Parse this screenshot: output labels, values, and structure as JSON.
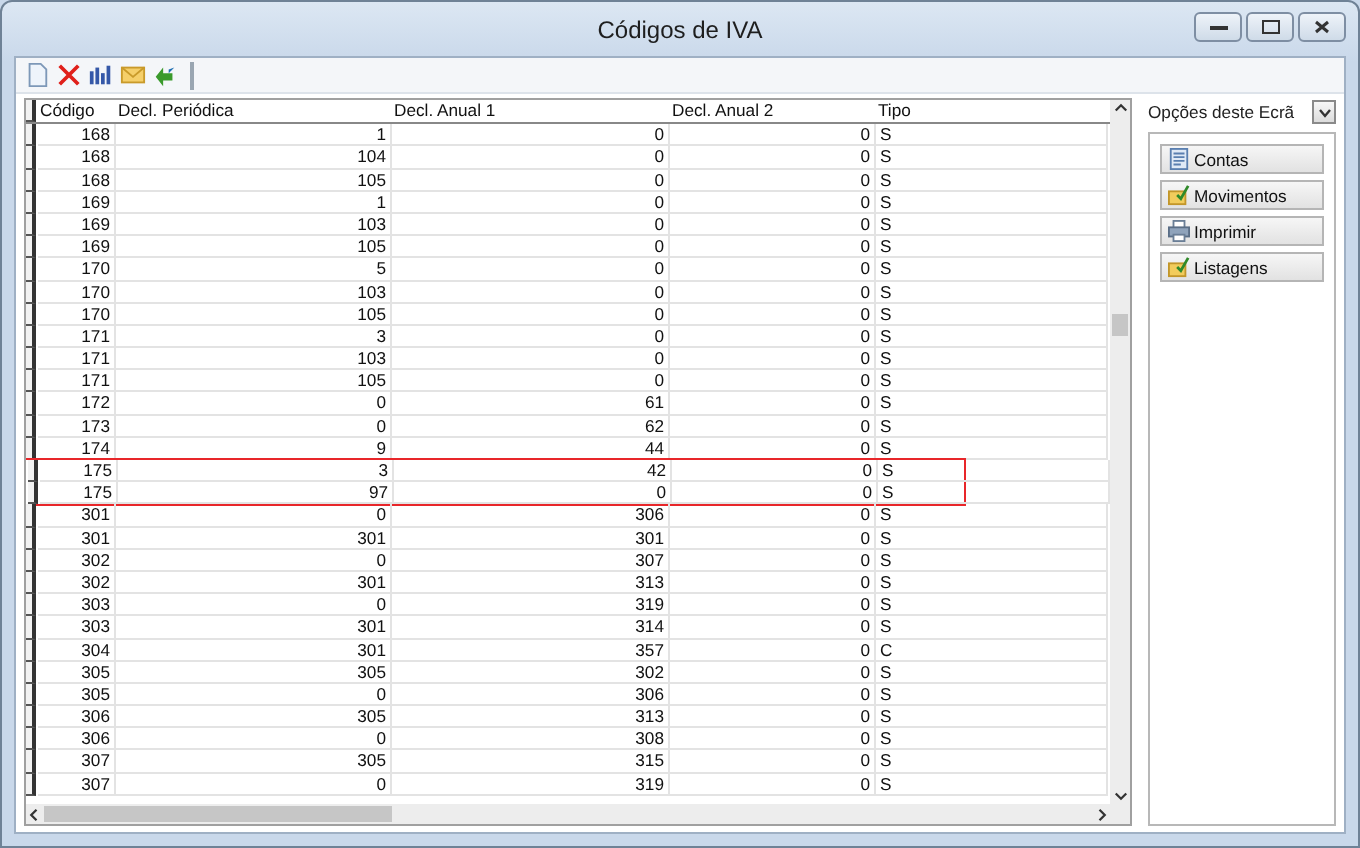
{
  "window": {
    "title": "Códigos de IVA"
  },
  "toolbar": {
    "buttons": [
      {
        "kind": "new"
      },
      {
        "kind": "delete"
      },
      {
        "kind": "chart"
      },
      {
        "kind": "mail"
      },
      {
        "kind": "refresh"
      }
    ]
  },
  "table": {
    "columns": [
      "Código",
      "Decl. Periódica",
      "Decl. Anual 1",
      "Decl. Anual 2",
      "Tipo"
    ],
    "rows": [
      {
        "cells": [
          "168",
          "1",
          "0",
          "0",
          "S"
        ],
        "marked": false
      },
      {
        "cells": [
          "168",
          "104",
          "0",
          "0",
          "S"
        ],
        "marked": false
      },
      {
        "cells": [
          "168",
          "105",
          "0",
          "0",
          "S"
        ],
        "marked": false
      },
      {
        "cells": [
          "169",
          "1",
          "0",
          "0",
          "S"
        ],
        "marked": false
      },
      {
        "cells": [
          "169",
          "103",
          "0",
          "0",
          "S"
        ],
        "marked": false
      },
      {
        "cells": [
          "169",
          "105",
          "0",
          "0",
          "S"
        ],
        "marked": false
      },
      {
        "cells": [
          "170",
          "5",
          "0",
          "0",
          "S"
        ],
        "marked": false
      },
      {
        "cells": [
          "170",
          "103",
          "0",
          "0",
          "S"
        ],
        "marked": false
      },
      {
        "cells": [
          "170",
          "105",
          "0",
          "0",
          "S"
        ],
        "marked": false
      },
      {
        "cells": [
          "171",
          "3",
          "0",
          "0",
          "S"
        ],
        "marked": false
      },
      {
        "cells": [
          "171",
          "103",
          "0",
          "0",
          "S"
        ],
        "marked": false
      },
      {
        "cells": [
          "171",
          "105",
          "0",
          "0",
          "S"
        ],
        "marked": false
      },
      {
        "cells": [
          "172",
          "0",
          "61",
          "0",
          "S"
        ],
        "marked": false
      },
      {
        "cells": [
          "173",
          "0",
          "62",
          "0",
          "S"
        ],
        "marked": false
      },
      {
        "cells": [
          "174",
          "9",
          "44",
          "0",
          "S"
        ],
        "marked": false
      },
      {
        "cells": [
          "175",
          "3",
          "42",
          "0",
          "S"
        ],
        "marked": true
      },
      {
        "cells": [
          "175",
          "97",
          "0",
          "0",
          "S"
        ],
        "marked": true
      },
      {
        "cells": [
          "301",
          "0",
          "306",
          "0",
          "S"
        ],
        "marked": false
      },
      {
        "cells": [
          "301",
          "301",
          "301",
          "0",
          "S"
        ],
        "marked": false
      },
      {
        "cells": [
          "302",
          "0",
          "307",
          "0",
          "S"
        ],
        "marked": false
      },
      {
        "cells": [
          "302",
          "301",
          "313",
          "0",
          "S"
        ],
        "marked": false
      },
      {
        "cells": [
          "303",
          "0",
          "319",
          "0",
          "S"
        ],
        "marked": false
      },
      {
        "cells": [
          "303",
          "301",
          "314",
          "0",
          "S"
        ],
        "marked": false
      },
      {
        "cells": [
          "304",
          "301",
          "357",
          "0",
          "C"
        ],
        "marked": false
      },
      {
        "cells": [
          "305",
          "305",
          "302",
          "0",
          "S"
        ],
        "marked": false
      },
      {
        "cells": [
          "305",
          "0",
          "306",
          "0",
          "S"
        ],
        "marked": false
      },
      {
        "cells": [
          "306",
          "305",
          "313",
          "0",
          "S"
        ],
        "marked": false
      },
      {
        "cells": [
          "306",
          "0",
          "308",
          "0",
          "S"
        ],
        "marked": false
      },
      {
        "cells": [
          "307",
          "305",
          "315",
          "0",
          "S"
        ],
        "marked": false
      },
      {
        "cells": [
          "307",
          "0",
          "319",
          "0",
          "S"
        ],
        "marked": false
      }
    ]
  },
  "options_panel": {
    "title": "Opções deste Ecrã",
    "buttons": [
      {
        "label": "Contas",
        "kind": "accounts"
      },
      {
        "label": "Movimentos",
        "kind": "entries"
      },
      {
        "label": "Imprimir",
        "kind": "print"
      },
      {
        "label": "Listagens",
        "kind": "entries"
      }
    ]
  }
}
